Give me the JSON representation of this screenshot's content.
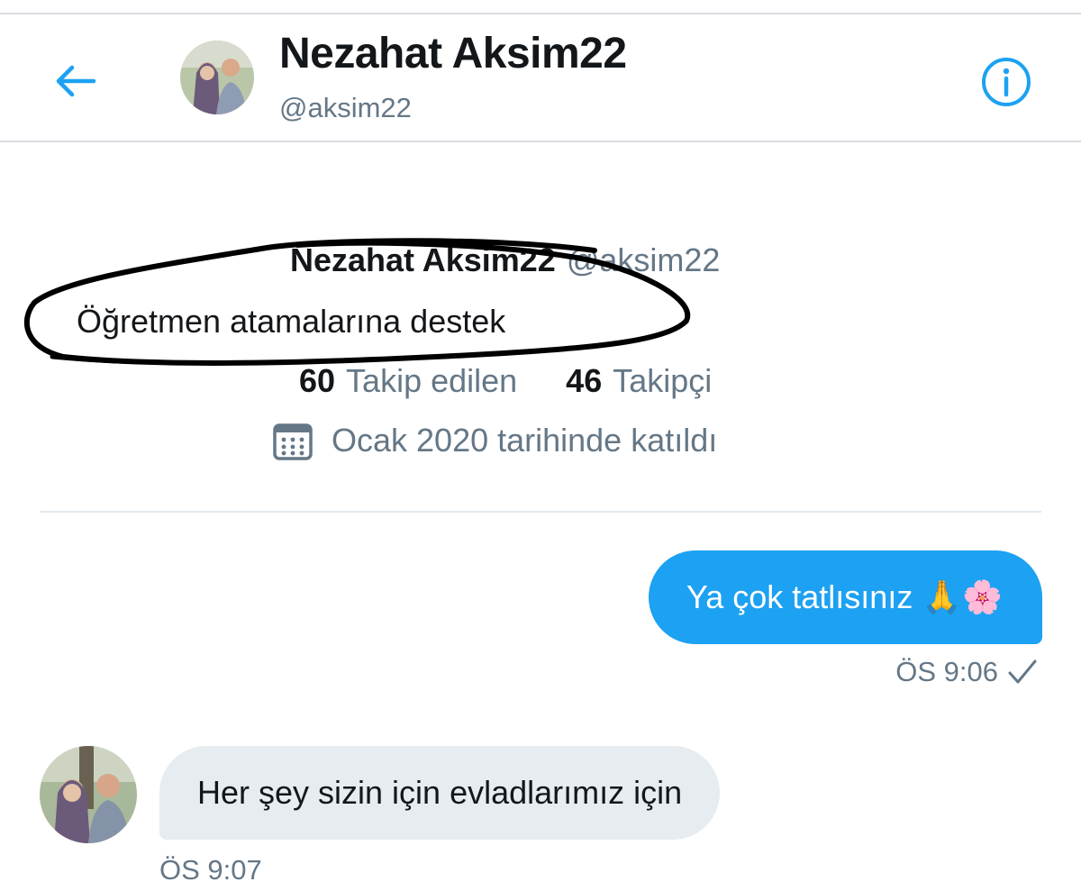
{
  "header": {
    "back_icon": "arrow-left-icon",
    "name": "Nezahat Aksim22",
    "handle": "@aksim22",
    "info_icon": "info-circle-icon"
  },
  "profile": {
    "name": "Nezahat Aksim22",
    "handle": "@aksim22",
    "bio": "Öğretmen atamalarına destek",
    "following_count": "60",
    "following_label": "Takip edilen",
    "followers_count": "46",
    "followers_label": "Takipçi",
    "joined_icon": "calendar-icon",
    "joined": "Ocak 2020 tarihinde katıldı"
  },
  "messages": [
    {
      "direction": "outgoing",
      "text": "Ya çok tatlısınız",
      "emoji": "🙏🌸",
      "time": "ÖS 9:06",
      "status_icon": "checkmark-icon"
    },
    {
      "direction": "incoming",
      "text": "Her şey sizin için evladlarımız için",
      "time": "ÖS 9:07"
    }
  ],
  "colors": {
    "accent": "#1da1f2",
    "incoming_bubble": "#e6ecf0",
    "secondary_text": "#657786",
    "primary_text": "#14171a"
  }
}
